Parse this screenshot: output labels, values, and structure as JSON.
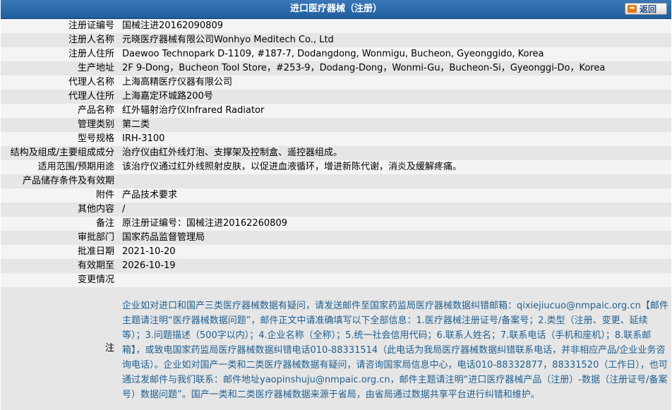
{
  "header": {
    "title": "进口医疗器械（注册）",
    "back_label": "返回"
  },
  "fields": [
    {
      "label": "注册证编号",
      "value": "国械注进20162090809"
    },
    {
      "label": "注册人名称",
      "value": "元晓医疗器械有限公司Wonhyo Meditech Co., Ltd"
    },
    {
      "label": "注册人住所",
      "value": "Daewoo Technopark D-1109, #187-7, Dodangdong, Wonmigu, Bucheon, Gyeonggido, Korea"
    },
    {
      "label": "生产地址",
      "value": "2F 9-Dong，Bucheon Tool Store，#253-9，Dodang-Dong，Wonmi-Gu，Bucheon-Si，Gyeonggi-Do，Korea"
    },
    {
      "label": "代理人名称",
      "value": "上海高精医疗仪器有限公司"
    },
    {
      "label": "代理人住所",
      "value": "上海嘉定环城路200号"
    },
    {
      "label": "产品名称",
      "value": "红外辐射治疗仪Infrared Radiator"
    },
    {
      "label": "管理类别",
      "value": "第二类"
    },
    {
      "label": "型号规格",
      "value": "IRH-3100"
    },
    {
      "label": "结构及组成/主要组成成分",
      "value": "治疗仪由红外线灯泡、支撑架及控制盒、遥控器组成。"
    },
    {
      "label": "适用范围/预期用途",
      "value": "该治疗仪通过红外线照射皮肤，以促进血液循环，增进新陈代谢，消炎及缓解疼痛。"
    },
    {
      "label": "产品储存条件及有效期",
      "value": ""
    },
    {
      "label": "附件",
      "value": "产品技术要求"
    },
    {
      "label": "其他内容",
      "value": "/"
    },
    {
      "label": "备注",
      "value": "原注册证编号：国械注进20162260809"
    },
    {
      "label": "审批部门",
      "value": "国家药品监督管理局"
    },
    {
      "label": "批准日期",
      "value": "2021-10-20"
    },
    {
      "label": "有效期至",
      "value": "2026-10-19"
    },
    {
      "label": "变更情况",
      "value": ""
    }
  ],
  "note": {
    "label": "注",
    "text": "企业如对进口和国产三类医疗器械数据有疑问，请发送邮件至国家药监局医疗器械数据纠错邮箱：qixiejiucuo@nmpaic.org.cn【邮件主题请注明“医疗器械数据问题”，邮件正文中请准确填写以下全部信息：1.医疗器械注册证号/备案号；2.类型（注册、变更、延续等）；3.问题描述（500字以内）；4.企业名称（全称）；5.统一社会信用代码；6.联系人姓名；7.联系电话（手机和座机）；8.联系邮箱】，或致电国家药监局医疗器械数据纠错电话010-88331514（此电话为我局医疗器械数据纠错联系电话，并非相应产品/企业业务咨询电话）。企业如对国产一类和二类医疗器械数据有疑问，请咨询国家局信息中心，电话010-88332877，88331520（工作日），也可通过发邮件与我们联系：邮件地址yaopinshuju@nmpaic.org.cn，邮件主题请注明“进口医疗器械产品（注册）-数据（注册证号/备案号）数据问题”。国产一类和二类医疗器械数据来源于省局，由省局通过数据共享平台进行纠错和维护。"
  }
}
